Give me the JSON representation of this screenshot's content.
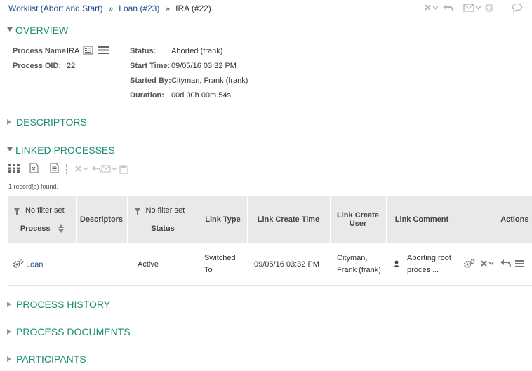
{
  "breadcrumb": {
    "items": [
      "Worklist (Abort and Start)",
      "Loan (#23)"
    ],
    "separator": "»",
    "current": "IRA (#22)"
  },
  "sections": {
    "overview": "OVERVIEW",
    "descriptors": "DESCRIPTORS",
    "linked": "LINKED PROCESSES",
    "history": "PROCESS HISTORY",
    "documents": "PROCESS DOCUMENTS",
    "participants": "PARTICIPANTS"
  },
  "overview": {
    "process_name_label": "Process Name:",
    "process_name": "IRA",
    "process_oid_label": "Process OID:",
    "process_oid": "22",
    "status_label": "Status:",
    "status": "Aborted (frank)",
    "start_time_label": "Start Time:",
    "start_time": "09/05/16 03:32 PM",
    "started_by_label": "Started By:",
    "started_by": "Cityman, Frank (frank)",
    "duration_label": "Duration:",
    "duration": "00d 00h 00m 54s"
  },
  "linked": {
    "records_found": "1 record(s) found.",
    "no_filter": "No filter set",
    "headers": {
      "process": "Process",
      "descriptors": "Descriptors",
      "status": "Status",
      "link_type": "Link Type",
      "link_create_time": "Link Create Time",
      "link_create_user": "Link Create User",
      "link_comment": "Link Comment",
      "actions": "Actions"
    },
    "rows": [
      {
        "process": "Loan",
        "descriptors": "",
        "status": "Active",
        "link_type": "Switched To",
        "link_create_time": "09/05/16 03:32 PM",
        "link_create_user": "Cityman, Frank (frank)",
        "link_comment": "Aborting root proces ..."
      }
    ]
  },
  "colors": {
    "section": "#1b8c76",
    "link": "#1f4e8c",
    "header_bg": "#e9e9e9"
  }
}
